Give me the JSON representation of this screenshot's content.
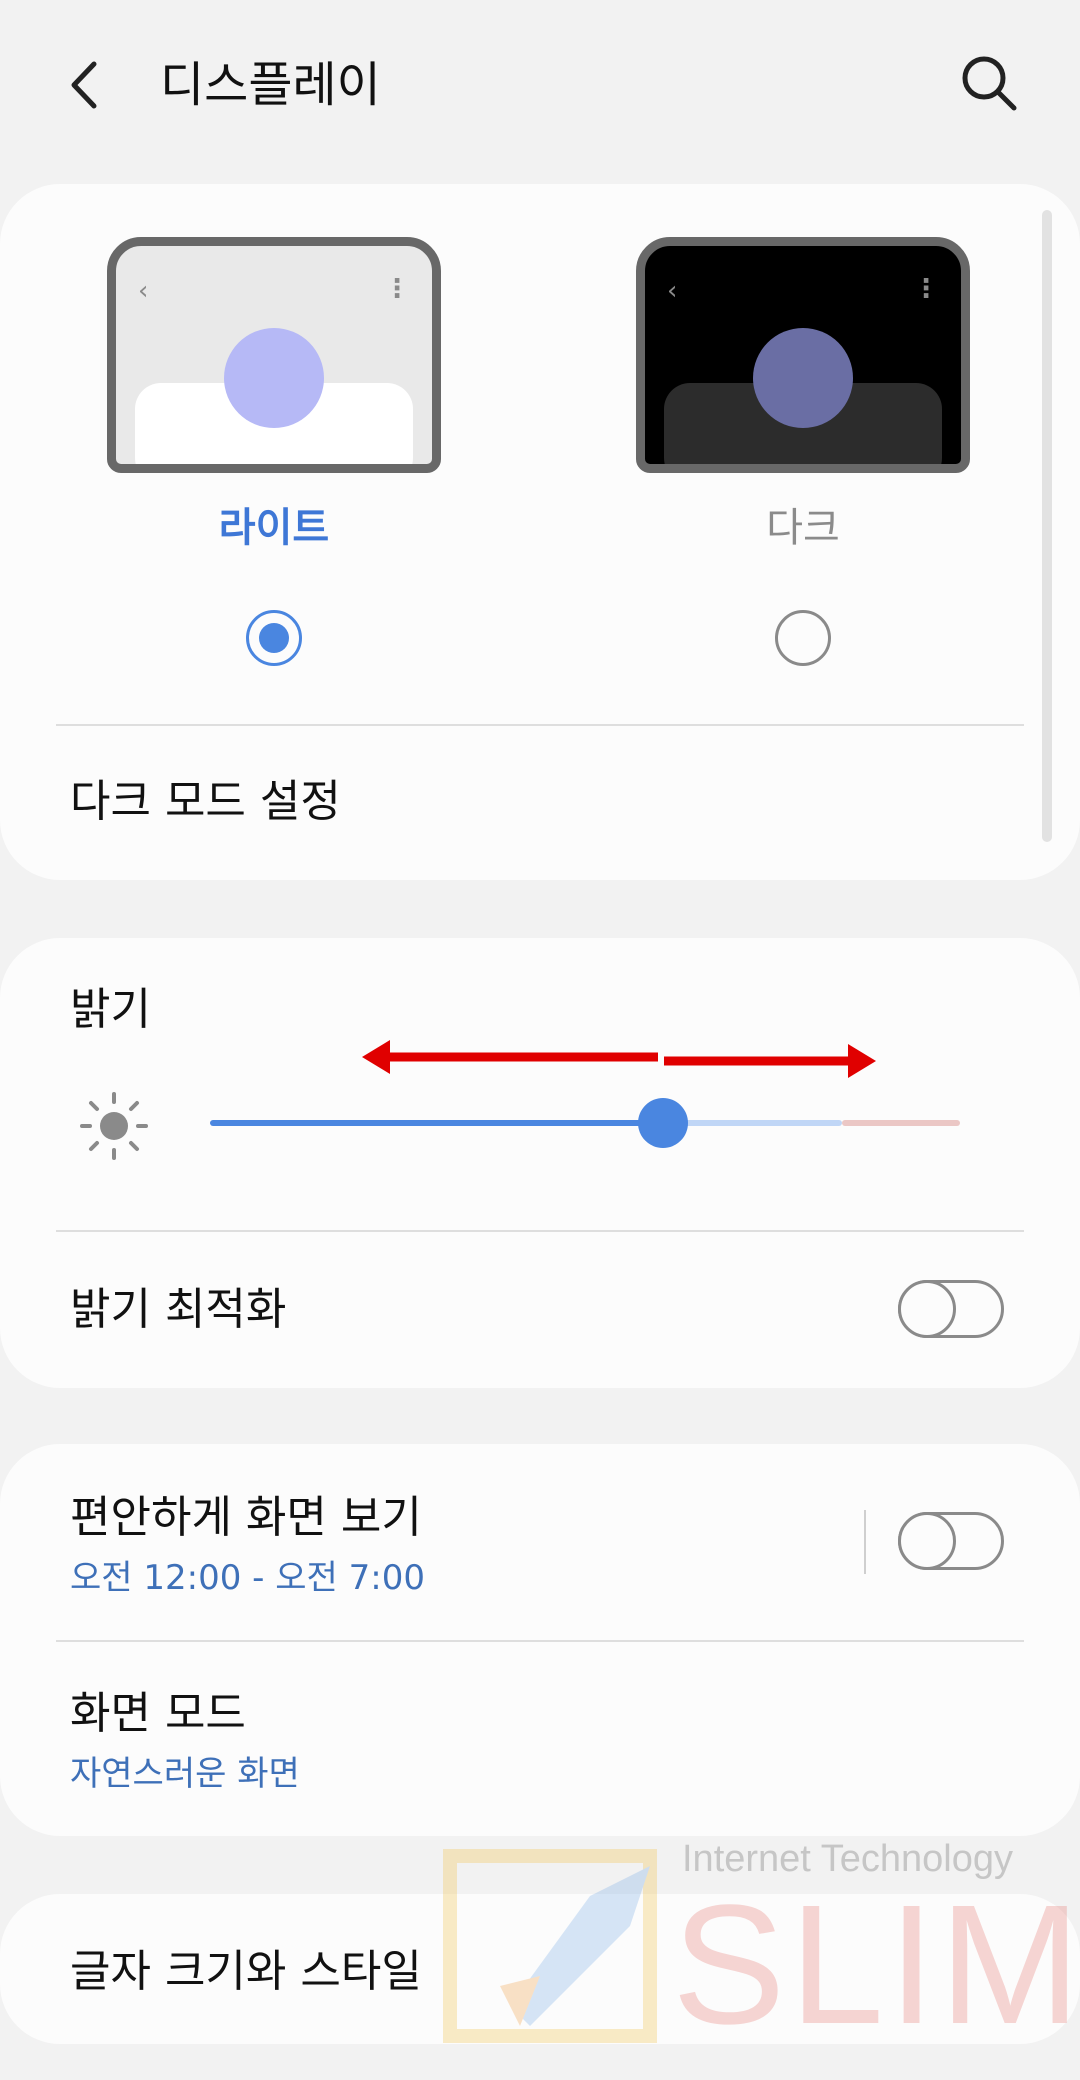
{
  "header": {
    "title": "디스플레이"
  },
  "theme": {
    "light_label": "라이트",
    "dark_label": "다크",
    "selected": "light"
  },
  "dark_mode_settings": {
    "label": "다크 모드 설정"
  },
  "brightness": {
    "label": "밝기",
    "value_fraction": 0.6
  },
  "adaptive_brightness": {
    "label": "밝기 최적화",
    "enabled": false
  },
  "eye_comfort": {
    "label": "편안하게 화면 보기",
    "schedule": "오전 12:00 - 오전 7:00",
    "enabled": false
  },
  "screen_mode": {
    "label": "화면 모드",
    "value": "자연스러운 화면"
  },
  "font_size_style": {
    "label": "글자 크기와 스타일"
  },
  "watermark": {
    "tagline": "Internet Technology",
    "brand": "SLIM"
  },
  "colors": {
    "accent": "#4a86e0",
    "link": "#3e70b8",
    "annotation_arrow": "#e00000"
  },
  "icons": {
    "back": "back-arrow-icon",
    "search": "search-icon",
    "brightness": "sun-icon"
  }
}
